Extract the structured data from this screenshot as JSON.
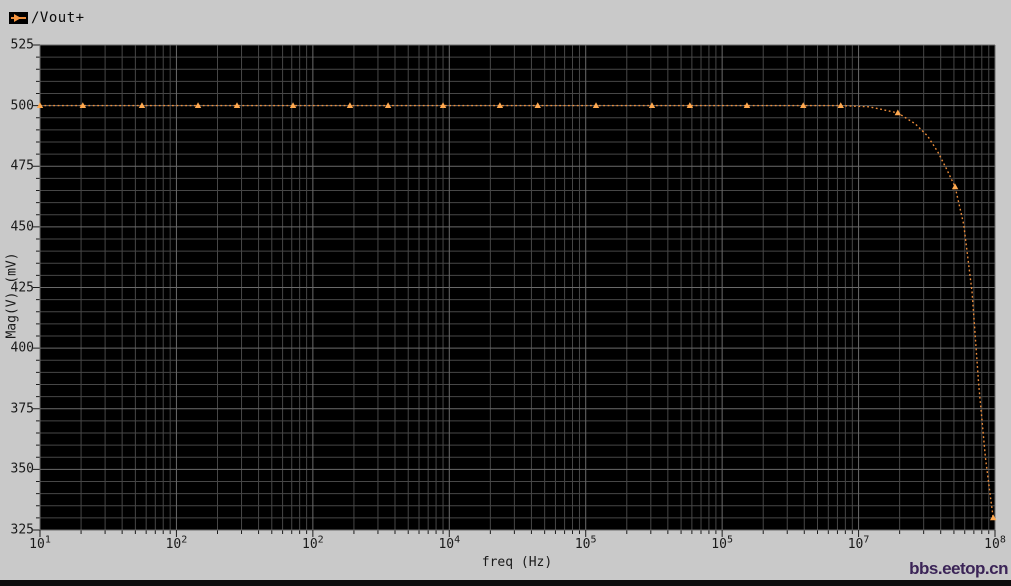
{
  "window": {
    "legend": {
      "label": "/Vout+",
      "swatch_icon": "trace-marker-sample"
    }
  },
  "axes": {
    "x_title": "freq (Hz)",
    "y_title": "Mag(V) (mV)"
  },
  "watermark": "bbs.eetop.cn",
  "colors": {
    "background": "#c9c9c9",
    "plot_bg": "#000000",
    "grid_minor": "#474747",
    "grid_major": "#6a6a6a",
    "tick": "#1c1c1c",
    "text": "#111111",
    "trace": "#ec8c3a",
    "marker": "#ffa950",
    "watermark": "#3b2457",
    "bottom_bar": "#0d0d0d"
  },
  "chart_data": {
    "type": "line",
    "title": "",
    "xlabel": "freq (Hz)",
    "ylabel": "Mag(V) (mV)",
    "x_scale": "log",
    "xlim": [
      10,
      100000000
    ],
    "ylim": [
      325,
      525
    ],
    "y_major_step": 25,
    "y_minor_step": 5,
    "grid": "on",
    "legend_position": "top-left",
    "x_tick_exponents": [
      "1",
      "2",
      "2",
      "4",
      "5",
      "5",
      "7",
      "8"
    ],
    "y_tick_labels": [
      "525",
      "500",
      "475",
      "450",
      "425",
      "400",
      "375",
      "350",
      "325"
    ],
    "series": [
      {
        "name": "/Vout+",
        "style": "dotted",
        "marker": "triangle",
        "points": [
          [
            10,
            500
          ],
          [
            20.6,
            500
          ],
          [
            55.9,
            500
          ],
          [
            144,
            500
          ],
          [
            278,
            500
          ],
          [
            716,
            500
          ],
          [
            1870,
            500
          ],
          [
            3560,
            500
          ],
          [
            9000,
            500
          ],
          [
            23500,
            500
          ],
          [
            44500,
            500
          ],
          [
            119000,
            500
          ],
          [
            306000,
            500
          ],
          [
            580000,
            500
          ],
          [
            1520000,
            500
          ],
          [
            3930000,
            500
          ],
          [
            7400000,
            500
          ],
          [
            19400000,
            497
          ],
          [
            51000000,
            466.5
          ],
          [
            97000000,
            330
          ]
        ],
        "curve_samples": [
          [
            10,
            500
          ],
          [
            7400000,
            500
          ],
          [
            12000000,
            499.5
          ],
          [
            19400000,
            497
          ],
          [
            26000000,
            492.5
          ],
          [
            32000000,
            487.5
          ],
          [
            38000000,
            481
          ],
          [
            44000000,
            474
          ],
          [
            51000000,
            466.5
          ],
          [
            59000000,
            451
          ],
          [
            68000000,
            423
          ],
          [
            76000000,
            385
          ],
          [
            85000000,
            355
          ],
          [
            91000000,
            342
          ],
          [
            97000000,
            330
          ]
        ]
      }
    ]
  }
}
